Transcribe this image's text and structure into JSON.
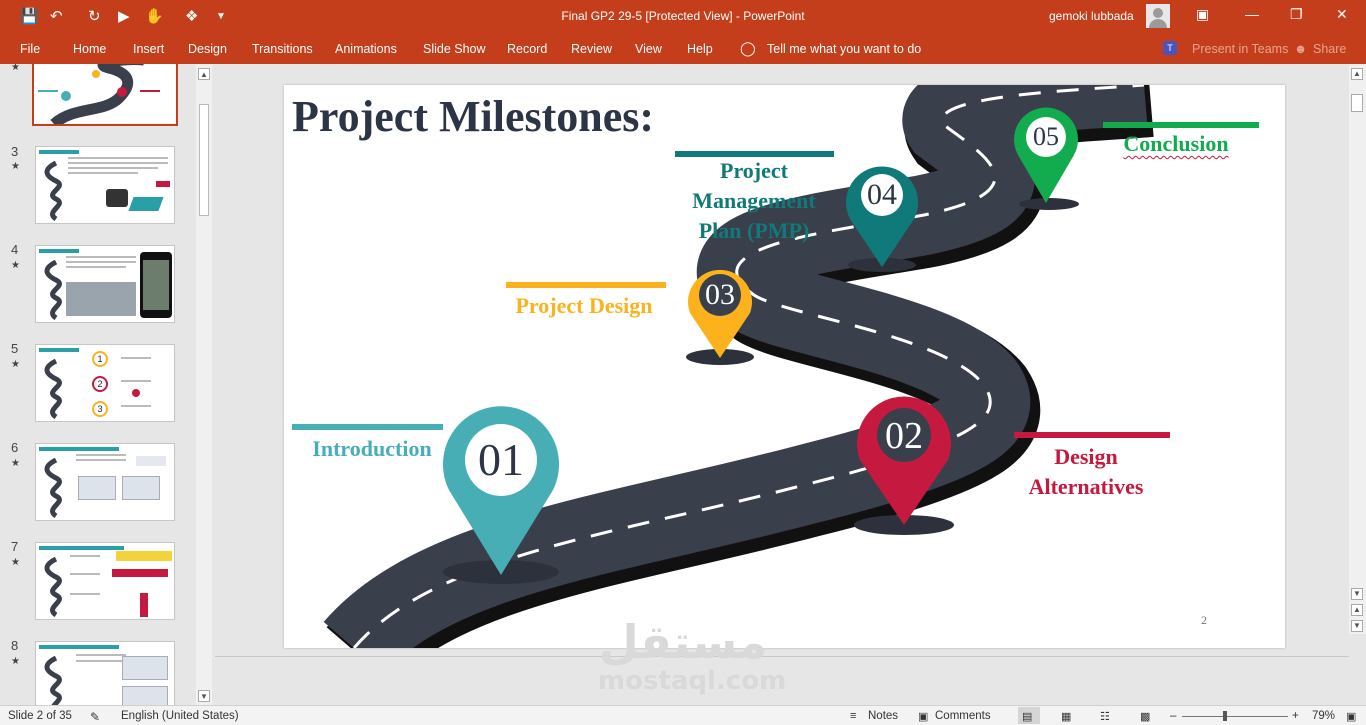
{
  "titlebar": {
    "title": "Final GP2 29-5 [Protected View]  -  PowerPoint",
    "user": "gemoki lubbada"
  },
  "ribbon": {
    "tabs": [
      "File",
      "Home",
      "Insert",
      "Design",
      "Transitions",
      "Animations",
      "Slide Show",
      "Record",
      "Review",
      "View",
      "Help"
    ],
    "tell_me": "Tell me what you want to do",
    "present_teams": "Present in Teams",
    "share": "Share"
  },
  "thumbnails": [
    {
      "num": "3",
      "title": "Introduction"
    },
    {
      "num": "4",
      "title": "Project Description"
    },
    {
      "num": "5",
      "title": "Design Alternatives"
    },
    {
      "num": "6",
      "title": "Alternative One (One-Way Ribbed Slab)"
    },
    {
      "num": "7",
      "title": "Design of Beam and Column (Ribbed Slab)"
    },
    {
      "num": "8",
      "title": "Alternative Two (One-Way Solid Slab)"
    }
  ],
  "slide": {
    "title": "Project Milestones:",
    "page_number": "2",
    "milestones": [
      {
        "num": "01",
        "label": "Introduction",
        "color": "#47aeb6"
      },
      {
        "num": "02",
        "label": "Design Alternatives",
        "color": "#c5193f"
      },
      {
        "num": "03",
        "label": "Project Design",
        "color": "#fbb21d"
      },
      {
        "num": "04",
        "label": "Project Management Plan (PMP)",
        "color": "#107a7a"
      },
      {
        "num": "05",
        "label": "Conclusion",
        "color": "#12ab4e"
      }
    ]
  },
  "watermark": {
    "arabic": "مستقل",
    "latin": "mostaql.com"
  },
  "status": {
    "slide_of": "Slide 2 of 35",
    "language": "English (United States)",
    "notes": "Notes",
    "comments": "Comments",
    "zoom": "79%"
  },
  "colors": {
    "accent": "#c43e1c",
    "road": "#3a3f4c",
    "title_text": "#2b3545"
  }
}
